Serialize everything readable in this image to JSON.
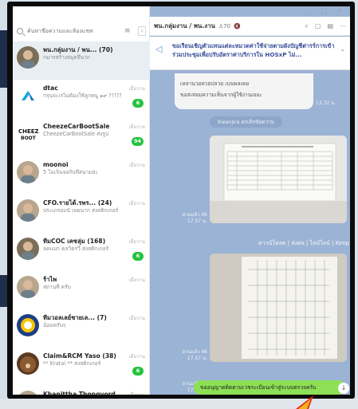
{
  "window": {
    "controls": "_ □ ×"
  },
  "sidebar": {
    "search_placeholder": "ค้นหาชื่อความและห้องแชท",
    "menu_icon": "≡",
    "collapse_icon": "‹",
    "chats": [
      {
        "name": "พน.กลุ่มงาน / พน... (70)",
        "message": "กมารสร้างสมุดจึนาก",
        "time": "",
        "badge": "",
        "active": true,
        "avatar": "group-photo"
      },
      {
        "name": "dtac",
        "message": "กรุนจะเรไม่ต้องใช้ลูกหนู ๑๙ ??!?? Buddy Reve...",
        "time": "เมื่อวาน",
        "badge": "6",
        "avatar": "dtac-logo"
      },
      {
        "name": "CheezeCarBootSale",
        "message": "CheezeCarBootSale ส่งรูป",
        "time": "เมื่อวาน",
        "badge": "94",
        "avatar": "cheeze-logo"
      },
      {
        "name": "moonoi",
        "message": "5 ไมเจ็นจอกับที่สนามย่ะ",
        "time": "เมื่อวาน",
        "badge": "",
        "avatar": "person-photo"
      },
      {
        "name": "CFO.รายได้.รพร... (24)",
        "message": "ประเภรอบนั่ เพยนาก ส่งสติกเกอร์",
        "time": "เมื่อวาน",
        "badge": "",
        "avatar": "person-photo"
      },
      {
        "name": "ทีมCOC เคชลุ่ม (168)",
        "message": "ลคแมก คลวิตรวี่ ส่งสติกเกอร์",
        "time": "เมื่อวาน",
        "badge": "6",
        "avatar": "group-photo"
      },
      {
        "name": "ร้าไพ",
        "message": "สถานที่ ครับ",
        "time": "เมื่อวาน",
        "badge": "",
        "avatar": "person-photo"
      },
      {
        "name": "ทีมวอลเลย์ชายเล... (7)",
        "message": "น้อมครับๆ",
        "time": "เมื่อวาน",
        "badge": "",
        "avatar": "volleyball-logo"
      },
      {
        "name": "Claim&RCM Yaso (38)",
        "message": "** Kratai ** ส่งสติกเกอร์",
        "time": "เมื่อวาน",
        "badge": "6",
        "avatar": "bear-avatar"
      },
      {
        "name": "Khanittha Thongyord",
        "message": "Khanittha Thongyord ส่งสติกเกอร์",
        "time": "เมื่อวาน",
        "badge": "",
        "avatar": "person-photo"
      }
    ]
  },
  "chat": {
    "title": "พน.กลุ่มงาน / พน.งาน",
    "member_count": "♙70",
    "mute_icon": "🔇",
    "header_icons": [
      "search-icon",
      "note-icon",
      "files-icon",
      "more-icon"
    ],
    "announcement": "ขอเรียนเชิญตัวแทนแต่ละหมวดค่าใช้จ่ายตามผังบัญชีต่ารร์การเข้าร่วมประชุมเพื่อปรับอัตราค่าบริการใน HOSxP ไม่...",
    "messages": {
      "text1_line1": "เหลานวยหวยปลวย เบนพลเคย",
      "text1_line2": "ขอสเห่อมความเห็นจากผู้ใช้งานเยอะ",
      "text1_time": "13.32 น.",
      "system": "Kwanjira ยกเลิกข้อความ",
      "img1_meta": "อ่านแล้ว 46\n17.57 น.",
      "img2_meta": "อ่านแล้ว 46\n17.57 น.",
      "actions": [
        "ดาวน์โหลด",
        "ส่งต่อ",
        "ไทม์ไลน์",
        "Keep"
      ],
      "mine_meta": "อ่านแล้ว 46\n17.57 น.",
      "mine_text": "ขออนุญาตติดตามเวชระเบียนเข้าสู่ระบบตรวจครับ",
      "scroll_icon": "↓"
    }
  },
  "colors": {
    "chat_bg": "#9bb3d5",
    "badge": "#26c33f",
    "my_bubble": "#8de055",
    "announcement": "#3a4f9a"
  }
}
